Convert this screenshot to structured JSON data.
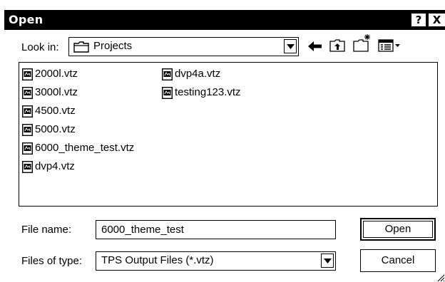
{
  "window": {
    "title": "Open",
    "help_glyph": "?",
    "close_glyph": "X"
  },
  "toolbar": {
    "look_in_label": "Look in:",
    "look_in_value": "Projects",
    "look_in_icon": "folder-icon",
    "back_icon": "back-arrow-icon",
    "up_icon": "up-one-level-icon",
    "new_folder_icon": "new-folder-icon",
    "view_menu_icon": "view-menu-icon"
  },
  "files": [
    {
      "name": "2000l.vtz",
      "icon": "vtz-file-icon"
    },
    {
      "name": "3000l.vtz",
      "icon": "vtz-file-icon"
    },
    {
      "name": "4500.vtz",
      "icon": "vtz-file-icon"
    },
    {
      "name": "5000.vtz",
      "icon": "vtz-file-icon"
    },
    {
      "name": "6000_theme_test.vtz",
      "icon": "vtz-file-icon"
    },
    {
      "name": "dvp4.vtz",
      "icon": "vtz-file-icon"
    },
    {
      "name": "dvp4a.vtz",
      "icon": "vtz-file-icon"
    },
    {
      "name": "testing123.vtz",
      "icon": "vtz-file-icon"
    }
  ],
  "filename": {
    "label": "File name:",
    "value": "6000_theme_test"
  },
  "filetype": {
    "label": "Files of type:",
    "value": "TPS Output Files (*.vtz)"
  },
  "buttons": {
    "open": "Open",
    "cancel": "Cancel"
  }
}
